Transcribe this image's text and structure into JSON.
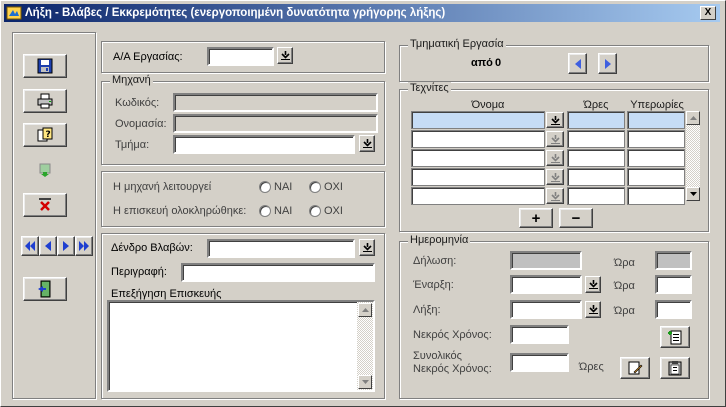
{
  "window": {
    "title": "Λήξη - Βλάβες / Εκκρεμότητες (ενεργοποιημένη δυνατότητα γρήγορης λήξης)",
    "close_label": "X"
  },
  "toolbar": {
    "icons": [
      "save-icon",
      "print-icon",
      "help-icon",
      "new-record-icon",
      "delete-icon",
      "first-record-icon",
      "previous-record-icon",
      "next-record-icon",
      "last-record-icon",
      "exit-icon"
    ]
  },
  "work": {
    "id_label": "Α/Α Εργασίας:",
    "id_value": ""
  },
  "machine": {
    "legend": "Μηχανή",
    "code_label": "Κωδικός:",
    "name_label": "Ονομασία:",
    "section_label": "Τμήμα:"
  },
  "status": {
    "running_label": "Η μηχανή λειτουργεί",
    "completed_label": "Η επισκευή ολοκληρώθηκε:",
    "yes": "ΝΑΙ",
    "no": "ΟΧΙ"
  },
  "fault": {
    "tree_label": "Δένδρο Βλαβών:",
    "description_label": "Περιγραφή:",
    "explanation_label": "Επεξήγηση Επισκευής"
  },
  "partial": {
    "legend": "Τμηματική Εργασία",
    "from_label": "από",
    "total": "0"
  },
  "technicians": {
    "legend": "Τεχνίτες",
    "columns": [
      "Όνομα",
      "Ώρες",
      "Υπερωρίες"
    ],
    "rows": 5,
    "add_label": "+",
    "remove_label": "−"
  },
  "dates": {
    "legend": "Ημερομηνία",
    "declaration_label": "Δήλωση:",
    "start_label": "Έναρξη:",
    "end_label": "Λήξη:",
    "dead_time_label": "Νεκρός Χρόνος:",
    "total_dead_label_1": "Συνολικός",
    "total_dead_label_2": "Νεκρός Χρόνος:",
    "time_label": "Ώρα",
    "hours_label": "Ώρες"
  },
  "colors": {
    "titlebar_start": "#0a246a",
    "titlebar_end": "#a6caf0",
    "face": "#d4d0c8",
    "selected_row": "#c6dcf5"
  }
}
